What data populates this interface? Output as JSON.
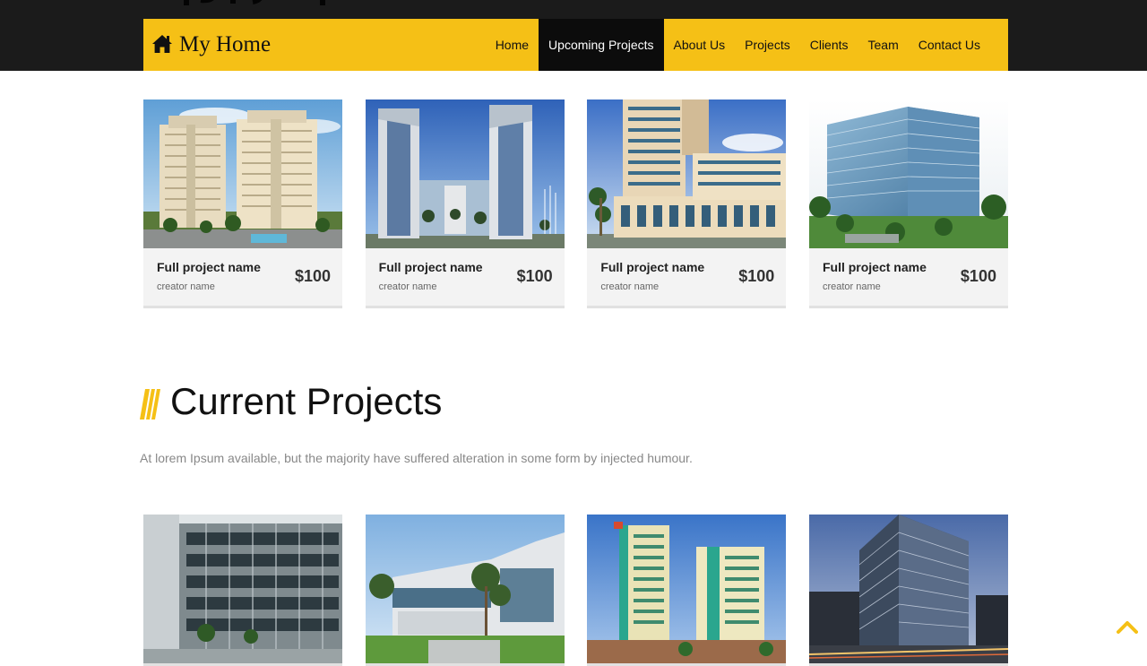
{
  "brand": {
    "name": "My Home",
    "icon": "home-icon"
  },
  "nav": {
    "items": [
      {
        "label": "Home",
        "active": false
      },
      {
        "label": "Upcoming Projects",
        "active": true
      },
      {
        "label": "About Us",
        "active": false
      },
      {
        "label": "Projects",
        "active": false
      },
      {
        "label": "Clients",
        "active": false
      },
      {
        "label": "Team",
        "active": false
      },
      {
        "label": "Contact Us",
        "active": false
      }
    ]
  },
  "upcoming": {
    "cards": [
      {
        "name": "Full project name",
        "creator": "creator name",
        "price": "$100",
        "image": "twin-residential-towers"
      },
      {
        "name": "Full project name",
        "creator": "creator name",
        "price": "$100",
        "image": "twin-glass-skyscrapers"
      },
      {
        "name": "Full project name",
        "creator": "creator name",
        "price": "$100",
        "image": "hotel-building"
      },
      {
        "name": "Full project name",
        "creator": "creator name",
        "price": "$100",
        "image": "glass-office-block"
      }
    ]
  },
  "current": {
    "title": "Current Projects",
    "description": "At lorem Ipsum available, but the majority have suffered alteration in some form by injected humour.",
    "cards": [
      {
        "image": "modern-office-street"
      },
      {
        "image": "low-rise-office-campus"
      },
      {
        "image": "colorful-apartment-towers"
      },
      {
        "image": "office-building-dusk"
      }
    ]
  },
  "colors": {
    "accent": "#f5c016",
    "active_nav": "#0c0c0c",
    "top_band": "#1b1b1b"
  }
}
